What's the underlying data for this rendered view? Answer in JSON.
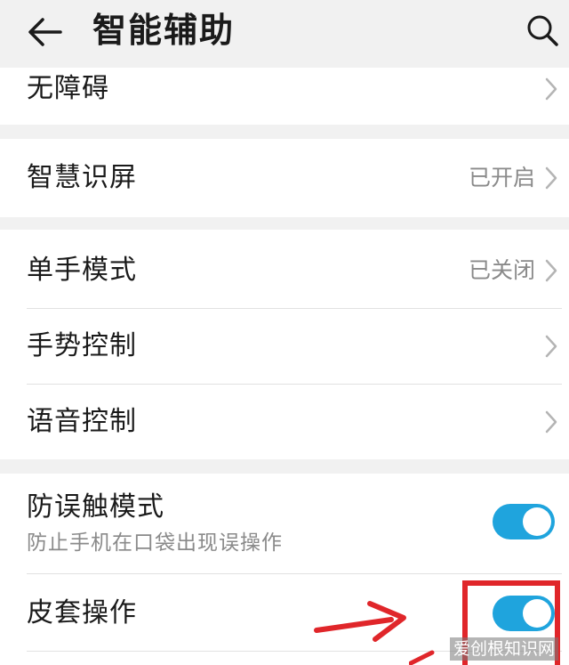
{
  "header": {
    "title": "智能辅助",
    "back_icon": "arrow-left-icon",
    "search_icon": "search-icon"
  },
  "groups": [
    {
      "items": [
        {
          "label": "无障碍",
          "value": ""
        }
      ]
    },
    {
      "items": [
        {
          "label": "智慧识屏",
          "value": "已开启"
        }
      ]
    },
    {
      "items": [
        {
          "label": "单手模式",
          "value": "已关闭"
        },
        {
          "label": "手势控制",
          "value": ""
        },
        {
          "label": "语音控制",
          "value": ""
        }
      ]
    },
    {
      "items": [
        {
          "label": "防误触模式",
          "subtitle": "防止手机在口袋出现误操作",
          "toggle": true
        },
        {
          "label": "皮套操作",
          "toggle": true
        }
      ]
    }
  ],
  "colors": {
    "accent": "#1fa4dd",
    "annotation": "#e0262a"
  },
  "watermark": "爱创根知识网"
}
